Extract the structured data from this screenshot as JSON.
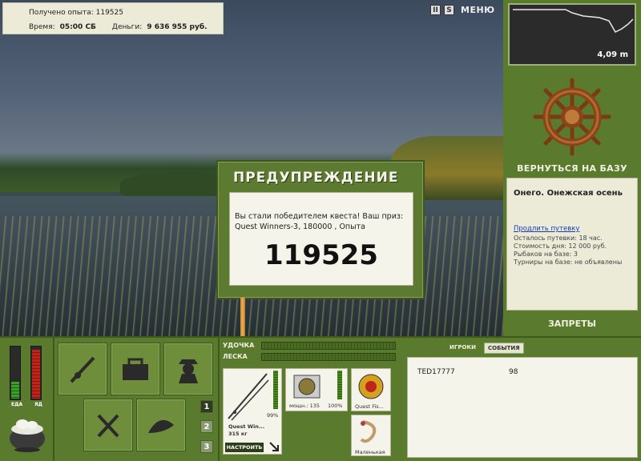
{
  "stats": {
    "xp_label": "Получено опыта:",
    "xp_value": "119525",
    "time_label": "Время:",
    "time_value": "05:00 СБ",
    "money_label": "Деньги:",
    "money_value": "9 636 955 руб."
  },
  "top_controls": {
    "pause_glyph": "II",
    "sound_glyph": "S",
    "menu_label": "МЕНЮ"
  },
  "depth": {
    "value": "4,09 m"
  },
  "base": {
    "return_label": "ВЕРНУТЬСЯ НА БАЗУ",
    "location": "Онего. Онежская осень",
    "extend_link": "Продлить путевку",
    "lines": [
      "Осталось путевки: 18 час.",
      "Стоимость дня: 12 000 руб.",
      "Рыбаков на базе: 3",
      "Турниры на базе: не объявлены"
    ],
    "bans_label": "ЗАПРЕТЫ"
  },
  "dialog": {
    "title": "ПРЕДУПРЕЖДЕНИЕ",
    "message": "Вы стали победителем квеста! Ваш приз: Quest Winners-3, 180000 , Опыта",
    "number": "119525"
  },
  "needs": {
    "food_label": "ЕДА",
    "food_level": 0.32,
    "poison_label": "ЯД",
    "poison_level": 0.92,
    "food_color": "#3aa02a",
    "poison_color": "#c02418"
  },
  "tool_pages": [
    "1",
    "2",
    "3"
  ],
  "tackle": {
    "rod_label": "УДОЧКА",
    "line_label": "ЛЕСКА",
    "rod_name": "Quest Win...",
    "rod_weight": "315 кг",
    "rod_percent": "99%",
    "setup_label": "НАСТРОИТЬ",
    "reel_label": "мощн.: 135",
    "reel_percent": "100%",
    "line_name": "Quest Fis...",
    "lure_name": "Маленькая"
  },
  "events": {
    "tab_players": "ИГРОКИ",
    "tab_events": "СОБЫТИЯ",
    "rows": [
      {
        "player": "TED17777",
        "value": "98"
      }
    ]
  }
}
